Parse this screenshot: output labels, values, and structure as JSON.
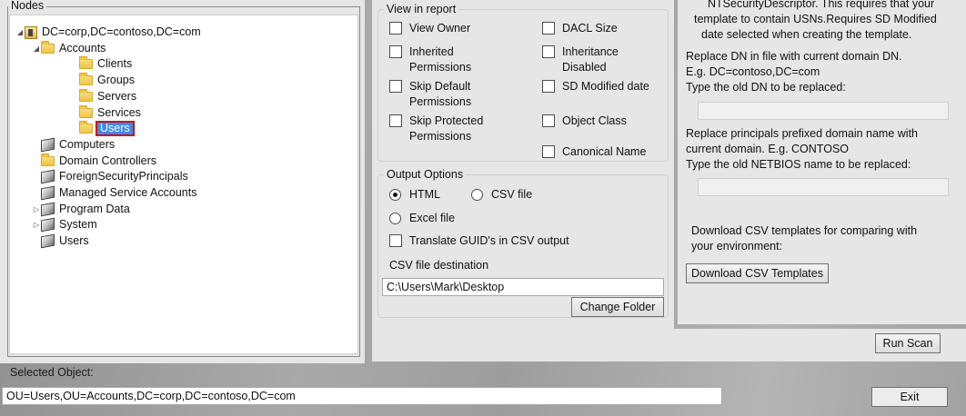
{
  "nodes": {
    "title": "Nodes",
    "tree": [
      {
        "label": "DC=corp,DC=contoso,DC=com",
        "arrow": "◢",
        "icon": "domain-icon",
        "level": 0
      },
      {
        "label": "Accounts",
        "arrow": "◢",
        "icon": "folder-icon",
        "level": 1
      },
      {
        "label": "Clients",
        "arrow": "",
        "icon": "folder-icon",
        "level": 2
      },
      {
        "label": "Groups",
        "arrow": "",
        "icon": "folder-icon",
        "level": 2
      },
      {
        "label": "Servers",
        "arrow": "",
        "icon": "folder-icon",
        "level": 2
      },
      {
        "label": "Services",
        "arrow": "",
        "icon": "folder-icon",
        "level": 2
      },
      {
        "label": "Users",
        "arrow": "",
        "icon": "folder-icon",
        "level": 2,
        "selected": true
      },
      {
        "label": "Computers",
        "arrow": "",
        "icon": "container-icon",
        "level": 1
      },
      {
        "label": "Domain Controllers",
        "arrow": "",
        "icon": "folder-icon",
        "level": 1
      },
      {
        "label": "ForeignSecurityPrincipals",
        "arrow": "",
        "icon": "container-icon",
        "level": 1
      },
      {
        "label": "Managed Service Accounts",
        "arrow": "",
        "icon": "container-icon",
        "level": 1
      },
      {
        "label": "Program Data",
        "arrow": "▷",
        "icon": "container-icon",
        "level": 1
      },
      {
        "label": "System",
        "arrow": "▷",
        "icon": "container-icon",
        "level": 1
      },
      {
        "label": "Users",
        "arrow": "",
        "icon": "container-icon",
        "level": 1
      }
    ]
  },
  "view_in_report": {
    "title": "View in report",
    "view_owner": "View Owner",
    "inherited_1": "Inherited",
    "inherited_2": "Permissions",
    "skip_default_1": "Skip Default",
    "skip_default_2": "Permissions",
    "skip_protected_1": "Skip Protected",
    "skip_protected_2": "Permissions",
    "dacl_size": "DACL Size",
    "inheritance_1": "Inheritance",
    "inheritance_2": "Disabled",
    "sd_modified": "SD Modified date",
    "object_class": "Object Class",
    "canonical_name": "Canonical Name"
  },
  "output_options": {
    "title": "Output Options",
    "html": "HTML",
    "csv_file": "CSV file",
    "excel_file": "Excel file",
    "translate_guid": "Translate GUID's in CSV output",
    "csv_dest_label": "CSV file destination",
    "csv_dest_value": "C:\\Users\\Mark\\Desktop",
    "change_folder": "Change Folder"
  },
  "right": {
    "line1": "NTSecurityDescriptor. This requires that your",
    "line2": "template to contain USNs.Requires SD Modified",
    "line3": "date selected when creating the template.",
    "replace_dn_1": "Replace DN in file with current domain DN.",
    "replace_dn_2": "E.g. DC=contoso,DC=com",
    "replace_dn_3": "Type the old DN to be replaced:",
    "replace_prn_1": "Replace principals prefixed domain name with",
    "replace_prn_2": "current domain. E.g. CONTOSO",
    "replace_prn_3": "Type the old NETBIOS name to be replaced:",
    "download_1": "Download CSV templates for comparing with",
    "download_2": "your environment:",
    "download_button": "Download CSV Templates"
  },
  "run_scan": "Run Scan",
  "selected_object": {
    "label": "Selected Object:",
    "value": "OU=Users,OU=Accounts,DC=corp,DC=contoso,DC=com"
  },
  "exit": "Exit"
}
